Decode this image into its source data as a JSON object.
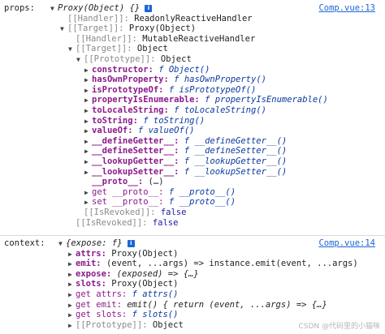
{
  "props": {
    "label": "props:",
    "source": "Comp.vue:13",
    "lines": [
      {
        "t": "down",
        "k": "",
        "kc": "",
        "v": "Proxy(Object) {}",
        "vc": "ital",
        "info": true
      },
      {
        "t": "none",
        "k": "[[Handler]]:",
        "kc": "key-grey",
        "v": "ReadonlyReactiveHandler",
        "vc": "obj"
      },
      {
        "t": "down",
        "k": "[[Target]]:",
        "kc": "key-grey",
        "v": "Proxy(Object)",
        "vc": "obj"
      },
      {
        "t": "none",
        "k": "[[Handler]]:",
        "kc": "key-grey",
        "v": "MutableReactiveHandler",
        "vc": "obj"
      },
      {
        "t": "down",
        "k": "[[Target]]:",
        "kc": "key-grey",
        "v": "Object",
        "vc": "obj"
      },
      {
        "t": "down",
        "k": "[[Prototype]]:",
        "kc": "key-grey",
        "v": "Object",
        "vc": "obj"
      },
      {
        "t": "right",
        "k": "constructor:",
        "kc": "key-purple",
        "v": "Object()",
        "vc": "fn"
      },
      {
        "t": "right",
        "k": "hasOwnProperty:",
        "kc": "key-purple",
        "v": "hasOwnProperty()",
        "vc": "fn"
      },
      {
        "t": "right",
        "k": "isPrototypeOf:",
        "kc": "key-purple",
        "v": "isPrototypeOf()",
        "vc": "fn"
      },
      {
        "t": "right",
        "k": "propertyIsEnumerable:",
        "kc": "key-purple",
        "v": "propertyIsEnumerable()",
        "vc": "fn"
      },
      {
        "t": "right",
        "k": "toLocaleString:",
        "kc": "key-purple",
        "v": "toLocaleString()",
        "vc": "fn"
      },
      {
        "t": "right",
        "k": "toString:",
        "kc": "key-purple",
        "v": "toString()",
        "vc": "fn"
      },
      {
        "t": "right",
        "k": "valueOf:",
        "kc": "key-purple",
        "v": "valueOf()",
        "vc": "fn"
      },
      {
        "t": "right",
        "k": "__defineGetter__:",
        "kc": "key-purple",
        "v": "__defineGetter__()",
        "vc": "fn"
      },
      {
        "t": "right",
        "k": "__defineSetter__:",
        "kc": "key-purple",
        "v": "__defineSetter__()",
        "vc": "fn"
      },
      {
        "t": "right",
        "k": "__lookupGetter__:",
        "kc": "key-purple",
        "v": "__lookupGetter__()",
        "vc": "fn"
      },
      {
        "t": "right",
        "k": "__lookupSetter__:",
        "kc": "key-purple",
        "v": "__lookupSetter__()",
        "vc": "fn"
      },
      {
        "t": "none",
        "k": "__proto__:",
        "kc": "key-purple",
        "v": "(…)",
        "vc": "obj"
      },
      {
        "t": "right",
        "k": "get __proto__:",
        "kc": "key-int",
        "v": "__proto__()",
        "vc": "fn"
      },
      {
        "t": "right",
        "k": "set __proto__:",
        "kc": "key-int",
        "v": "__proto__()",
        "vc": "fn"
      },
      {
        "t": "none",
        "k": "[[IsRevoked]]:",
        "kc": "key-grey",
        "v": "false",
        "vc": "bool"
      },
      {
        "t": "none",
        "k": "[[IsRevoked]]:",
        "kc": "key-grey",
        "v": "false",
        "vc": "bool"
      }
    ]
  },
  "context": {
    "label": "context:",
    "source": "Comp.vue:14",
    "lines": [
      {
        "t": "down",
        "k": "",
        "kc": "",
        "v": "{expose: f}",
        "vc": "ital",
        "info": true
      },
      {
        "t": "right",
        "k": "attrs:",
        "kc": "key-purple",
        "v": "Proxy(Object)",
        "vc": "obj"
      },
      {
        "t": "right",
        "k": "emit:",
        "kc": "key-purple",
        "v": "(event, ...args) => instance.emit(event, ...args)",
        "vc": "obj"
      },
      {
        "t": "right",
        "k": "expose:",
        "kc": "key-purple",
        "v": "(exposed) => {…}",
        "vc": "ital"
      },
      {
        "t": "right",
        "k": "slots:",
        "kc": "key-purple",
        "v": "Proxy(Object)",
        "vc": "obj"
      },
      {
        "t": "right",
        "k": "get attrs:",
        "kc": "key-int",
        "v": "attrs()",
        "vc": "fn"
      },
      {
        "t": "right",
        "k": "get emit:",
        "kc": "key-int",
        "v": "emit() { return (event, ...args) => {…}",
        "vc": "ital"
      },
      {
        "t": "right",
        "k": "get slots:",
        "kc": "key-int",
        "v": "slots()",
        "vc": "fn"
      },
      {
        "t": "right",
        "k": "[[Prototype]]:",
        "kc": "key-grey",
        "v": "Object",
        "vc": "obj"
      }
    ]
  },
  "symbols": {
    "f": "f",
    "down": "▼",
    "right": "▶",
    "info": "i"
  },
  "watermark": "CSDN @代码里的小猫咪"
}
